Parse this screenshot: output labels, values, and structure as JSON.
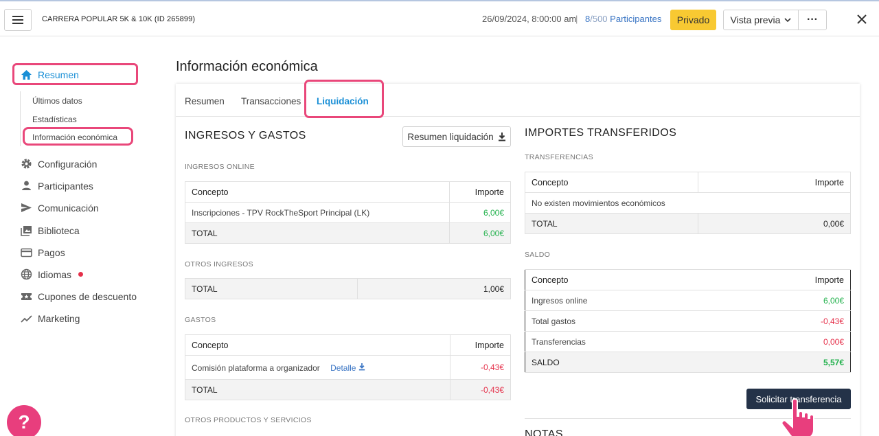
{
  "topbar": {
    "event_title": "CARRERA POPULAR 5K & 10K (ID 265899)",
    "date": "26/09/2024, 8:00:00 am",
    "separator": "|",
    "participants_count": "8",
    "participants_max": "/500",
    "participants_label": "Participantes",
    "privado_label": "Privado",
    "vista_previa_label": "Vista previa",
    "more_label": "···"
  },
  "sidebar": {
    "main_label": "Resumen",
    "sub_items": [
      "Últimos datos",
      "Estadísticas",
      "Información económica"
    ],
    "items": [
      "Configuración",
      "Participantes",
      "Comunicación",
      "Biblioteca",
      "Pagos",
      "Idiomas",
      "Cupones de descuento",
      "Marketing"
    ]
  },
  "help_label": "?",
  "main": {
    "title": "Información económica",
    "tabs": [
      "Resumen",
      "Transacciones",
      "Liquidación"
    ],
    "left": {
      "heading": "INGRESOS Y GASTOS",
      "resumen_btn": "Resumen liquidación",
      "ingresos_online": {
        "label": "INGRESOS ONLINE",
        "headers": [
          "Concepto",
          "Importe"
        ],
        "rows": [
          [
            "Inscripciones - TPV RockTheSport Principal (LK)",
            "6,00€"
          ]
        ],
        "total": [
          "TOTAL",
          "6,00€"
        ]
      },
      "otros_ingresos": {
        "label": "OTROS INGRESOS",
        "total": [
          "TOTAL",
          "1,00€"
        ]
      },
      "gastos": {
        "label": "GASTOS",
        "headers": [
          "Concepto",
          "Importe"
        ],
        "row_label": "Comisión plataforma a organizador",
        "row_link": "Detalle",
        "row_value": "-0,43€",
        "total": [
          "TOTAL",
          "-0,43€"
        ]
      },
      "otros_productos": {
        "label": "OTROS PRODUCTOS Y SERVICIOS"
      }
    },
    "right": {
      "heading": "IMPORTES TRANSFERIDOS",
      "transferencias": {
        "label": "TRANSFERENCIAS",
        "headers": [
          "Concepto",
          "Importe"
        ],
        "empty": "No existen movimientos económicos",
        "total": [
          "TOTAL",
          "0,00€"
        ]
      },
      "saldo": {
        "label": "SALDO",
        "headers": [
          "Concepto",
          "Importe"
        ],
        "rows": [
          [
            "Ingresos online",
            "6,00€"
          ],
          [
            "Total gastos",
            "-0,43€"
          ],
          [
            "Transferencias",
            "0,00€"
          ]
        ],
        "total": [
          "SALDO",
          "5,57€"
        ]
      },
      "solicitar_btn": "Solicitar transferencia",
      "notas_heading": "NOTAS"
    }
  },
  "colors": {
    "accent": "#1a8fd6",
    "highlight": "#e9477a",
    "privado": "#f8c932",
    "positive": "#22b14c",
    "negative": "#e5304a",
    "dark_button": "#243248"
  }
}
